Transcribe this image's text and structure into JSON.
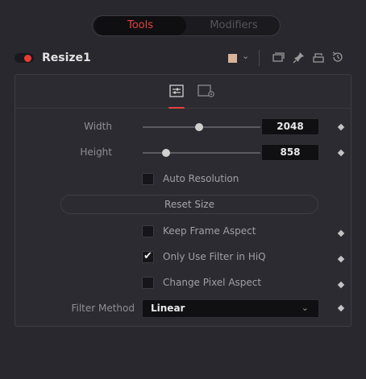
{
  "tabs": {
    "tools_label": "Tools",
    "modifiers_label": "Modifiers"
  },
  "node": {
    "name": "Resize1",
    "swatch_color": "#d8b39a",
    "toggle_color": "#ec3b33",
    "header_icons": [
      "dropdown-chevron-icon",
      "window-icon",
      "pin-icon",
      "lock-icon",
      "reset-icon"
    ]
  },
  "accent_color": "#e5433d",
  "subtabs": [
    "controls-icon",
    "settings-icon"
  ],
  "controls": {
    "width": {
      "label": "Width",
      "value": "2048",
      "slider_level": 0.48
    },
    "height": {
      "label": "Height",
      "value": "858",
      "slider_level": 0.2
    },
    "auto_resolution": {
      "label": "Auto Resolution",
      "checked": false
    },
    "reset_size_label": "Reset Size",
    "keep_frame_aspect": {
      "label": "Keep Frame Aspect",
      "checked": false
    },
    "only_use_filter_hiq": {
      "label": "Only Use Filter in HiQ",
      "checked": true
    },
    "change_pixel_aspect": {
      "label": "Change Pixel Aspect",
      "checked": false
    },
    "filter_method": {
      "label": "Filter Method",
      "value": "Linear"
    }
  }
}
